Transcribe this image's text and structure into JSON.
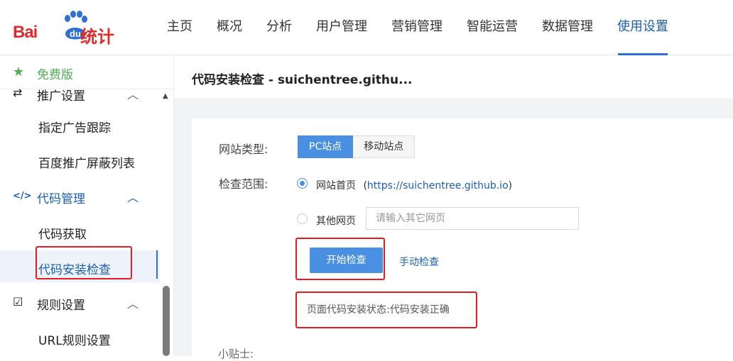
{
  "brand": {
    "logo_latin": "Bai",
    "logo_du": "du",
    "logo_cn": "统计",
    "brand_color": "#e12b2b"
  },
  "topnav": {
    "items": [
      {
        "label": "主页"
      },
      {
        "label": "概况"
      },
      {
        "label": "分析"
      },
      {
        "label": "用户管理"
      },
      {
        "label": "营销管理"
      },
      {
        "label": "智能运营"
      },
      {
        "label": "数据管理"
      },
      {
        "label": "使用设置",
        "active": true
      }
    ],
    "accent_color": "#2e6fd8"
  },
  "sidebar": {
    "free_label": "免费版",
    "free_icon": "star-icon",
    "items": [
      {
        "label": "推广设置",
        "icon": "promotion-icon",
        "type": "group",
        "expanded": true
      },
      {
        "label": "指定广告跟踪",
        "type": "sub"
      },
      {
        "label": "百度推广屏蔽列表",
        "type": "sub"
      },
      {
        "label": "代码管理",
        "icon": "code-icon",
        "type": "group",
        "expanded": true
      },
      {
        "label": "代码获取",
        "type": "sub"
      },
      {
        "label": "代码安装检查",
        "type": "sub",
        "selected": true
      },
      {
        "label": "规则设置",
        "icon": "edit-rules-icon",
        "type": "group",
        "expanded": true
      },
      {
        "label": "URL规则设置",
        "type": "sub"
      }
    ]
  },
  "main": {
    "title": "代码安装检查 - suichentree.githu...",
    "site_type_label": "网站类型:",
    "site_types": [
      {
        "label": "PC站点",
        "selected": true
      },
      {
        "label": "移动站点",
        "selected": false
      }
    ],
    "scope_label": "检查范围:",
    "scope_home_label": "网站首页",
    "scope_home_url_prefix": "(",
    "scope_home_url": "https://suichentree.github.io",
    "scope_home_url_suffix": ")",
    "scope_home_checked": true,
    "scope_other_label": "其他网页",
    "scope_other_checked": false,
    "other_input_placeholder": "请输入其它网页",
    "other_input_value": "",
    "start_button": "开始检查",
    "manual_link": "手动检查",
    "status_text": "页面代码安装状态:代码安装正确",
    "tip_label": "小贴士:"
  }
}
